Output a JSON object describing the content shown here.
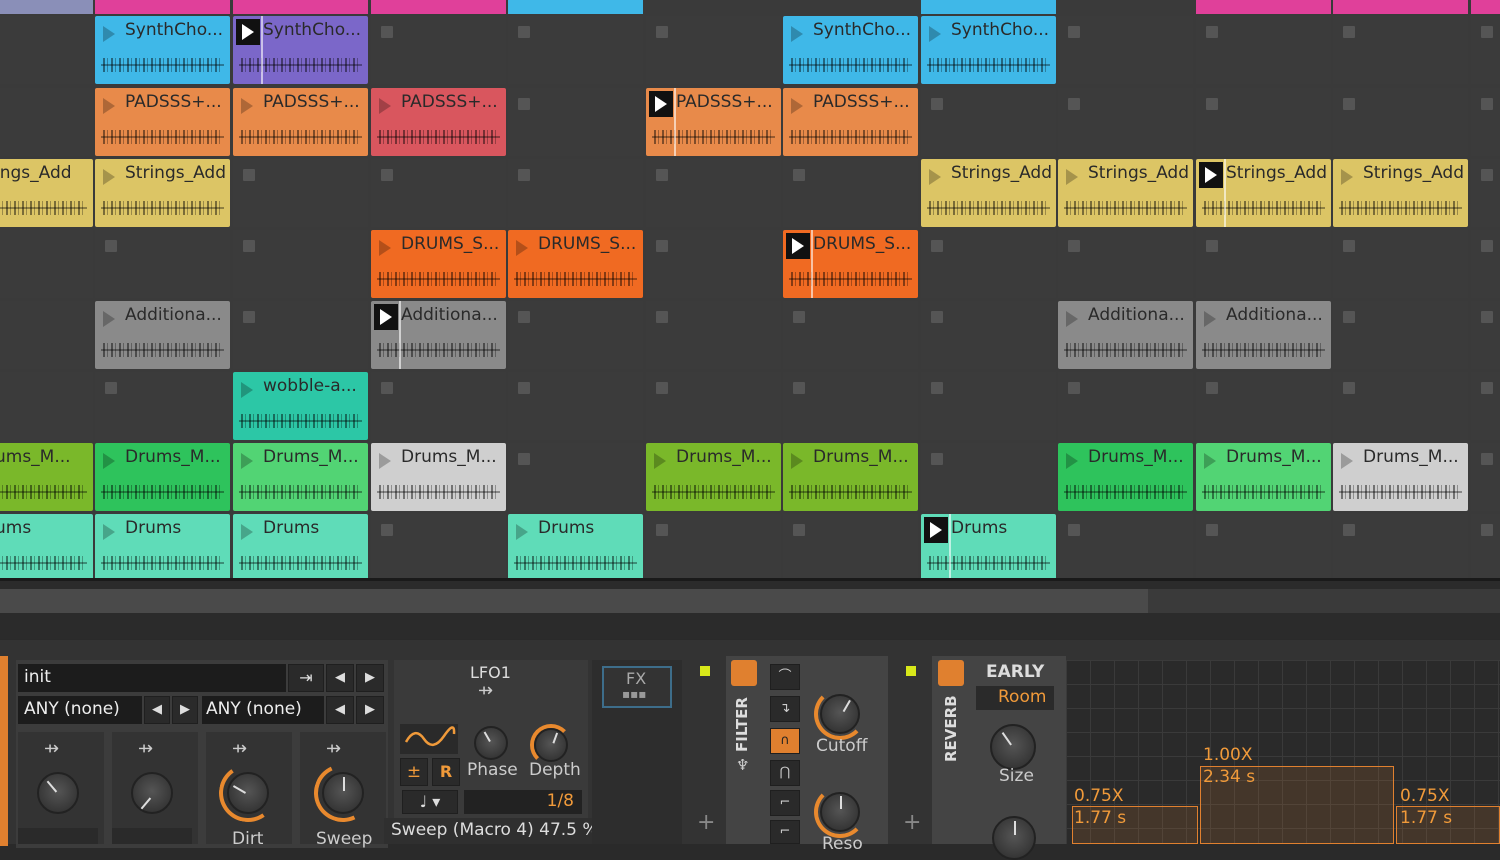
{
  "clip_launcher": {
    "rows": [
      {
        "clips": [
          {
            "col": 1,
            "name": "SynthCho...",
            "color": "#3fb8e8"
          },
          {
            "col": 2,
            "name": "SynthCho...",
            "color": "#7b67c9",
            "playing": true
          },
          {
            "col": 6,
            "name": "SynthCho...",
            "color": "#3fb8e8"
          },
          {
            "col": 7,
            "name": "SynthCho...",
            "color": "#3fb8e8"
          }
        ]
      },
      {
        "clips": [
          {
            "col": 1,
            "name": "PADSSS+...",
            "color": "#e88a4a"
          },
          {
            "col": 2,
            "name": "PADSSS+...",
            "color": "#e88a4a"
          },
          {
            "col": 3,
            "name": "PADSSS+...",
            "color": "#d9565e"
          },
          {
            "col": 5,
            "name": "PADSSS+...",
            "color": "#e88a4a",
            "playing": true
          },
          {
            "col": 6,
            "name": "PADSSS+...",
            "color": "#e88a4a"
          }
        ]
      },
      {
        "clips": [
          {
            "col": 0,
            "name": "rings_Add",
            "color": "#dcc565"
          },
          {
            "col": 1,
            "name": "Strings_Add",
            "color": "#dcc565"
          },
          {
            "col": 7,
            "name": "Strings_Add",
            "color": "#dcc565"
          },
          {
            "col": 8,
            "name": "Strings_Add",
            "color": "#dcc565"
          },
          {
            "col": 9,
            "name": "Strings_Add",
            "color": "#dcc565",
            "playing": true
          },
          {
            "col": 10,
            "name": "Strings_Add",
            "color": "#dcc565"
          }
        ]
      },
      {
        "clips": [
          {
            "col": 3,
            "name": "DRUMS_S...",
            "color": "#f06a22"
          },
          {
            "col": 4,
            "name": "DRUMS_S...",
            "color": "#f06a22"
          },
          {
            "col": 6,
            "name": "DRUMS_S...",
            "color": "#f06a22",
            "playing": true
          }
        ]
      },
      {
        "clips": [
          {
            "col": 1,
            "name": "Additiona...",
            "color": "#8a8a8a"
          },
          {
            "col": 3,
            "name": "Additiona...",
            "color": "#8a8a8a",
            "playing": true
          },
          {
            "col": 8,
            "name": "Additiona...",
            "color": "#8a8a8a"
          },
          {
            "col": 9,
            "name": "Additiona...",
            "color": "#8a8a8a"
          }
        ]
      },
      {
        "clips": [
          {
            "col": 2,
            "name": "wobble-a...",
            "color": "#2cc7a6"
          }
        ]
      },
      {
        "clips": [
          {
            "col": 0,
            "name": "rums_M...",
            "color": "#7ab82a"
          },
          {
            "col": 1,
            "name": "Drums_M...",
            "color": "#2ec35c"
          },
          {
            "col": 2,
            "name": "Drums_M...",
            "color": "#52d474"
          },
          {
            "col": 3,
            "name": "Drums_M...",
            "color": "#cfcfcf"
          },
          {
            "col": 5,
            "name": "Drums_M...",
            "color": "#7ab82a"
          },
          {
            "col": 6,
            "name": "Drums_M...",
            "color": "#7ab82a"
          },
          {
            "col": 8,
            "name": "Drums_M...",
            "color": "#2ec35c"
          },
          {
            "col": 9,
            "name": "Drums_M...",
            "color": "#52d474"
          },
          {
            "col": 10,
            "name": "Drums_M...",
            "color": "#cfcfcf"
          }
        ]
      },
      {
        "clips": [
          {
            "col": 0,
            "name": "rums",
            "color": "#5fdcb8"
          },
          {
            "col": 1,
            "name": "Drums",
            "color": "#5fdcb8"
          },
          {
            "col": 2,
            "name": "Drums",
            "color": "#5fdcb8"
          },
          {
            "col": 4,
            "name": "Drums",
            "color": "#5fdcb8"
          },
          {
            "col": 7,
            "name": "Drums",
            "color": "#5fdcb8",
            "playing": true
          }
        ]
      }
    ]
  },
  "device_panel": {
    "preset_name": "init",
    "filter1": "ANY (none)",
    "filter2": "ANY (none)",
    "macro_labels": [
      "Dirt",
      "Sweep"
    ],
    "lfo_title": "LFO1",
    "lfo_phase": "Phase",
    "lfo_depth": "Depth",
    "lfo_rate": "1/8",
    "lfo_bipolar": "±",
    "lfo_retrig": "R",
    "tooltip": "Sweep (Macro 4) 47.5 %",
    "fx_label": "FX",
    "filter_title": "FILTER",
    "cutoff": "Cutoff",
    "reso": "Reso",
    "reverb_title": "REVERB",
    "early_label": "EARLY",
    "room_label": "Room",
    "size_label": "Size",
    "reflections": [
      {
        "factor": "0.75X",
        "time": "1.77 s"
      },
      {
        "factor": "1.00X",
        "time": "2.34 s"
      },
      {
        "factor": "0.75X",
        "time": "1.77 s"
      }
    ],
    "colors": {
      "accent": "#f09a3a",
      "led": "#d8e81a"
    }
  }
}
